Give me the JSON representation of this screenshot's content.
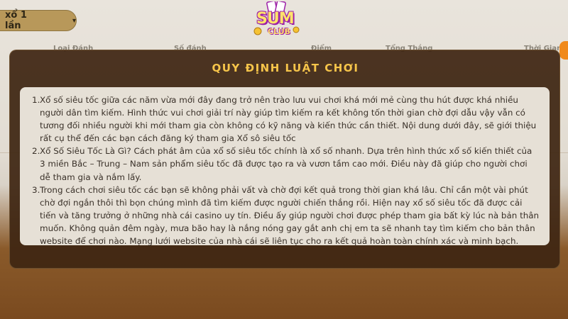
{
  "background": {
    "dropdown_label": "xổ 1 lần",
    "header_columns": [
      "Loại Đánh",
      "Số đánh",
      "Điểm",
      "Tổng Thắng",
      "Thời Gian"
    ],
    "logo": {
      "main": "SUM",
      "sub": "CLUB"
    }
  },
  "modal": {
    "title": "QUY ĐỊNH LUẬT CHƠI",
    "items": [
      {
        "num": "1.",
        "text": "Xổ số siêu tốc giữa các năm vừa mới đây đang trở nên trào lưu vui chơi khá mới mẻ cùng thu hút được khá nhiều người dân tìm kiếm. Hình thức vui chơi giải trí này giúp tìm kiếm ra kết không tốn thời gian chờ đợi dẫu vậy vẫn có tương đối nhiều người khi mới tham gia còn không có kỹ năng và kiến thức cần thiết. Nội dung dưới đây, sẽ giới thiệu rất cụ thể đến các bạn cách đăng ký tham gia Xổ sô siêu tốc"
      },
      {
        "num": "2.",
        "text": "Xổ Số Siêu Tốc Là Gì? Cách phát âm của xổ số siêu tốc chính là xổ số nhanh. Dựa trên hình thức xổ số kiến thiết của 3 miền Bắc – Trung – Nam sản phẩm siêu tốc đã được tạo ra và vươn tầm cao mới. Điều này đã giúp cho người chơi dễ tham gia và nắm lấy."
      },
      {
        "num": "3.",
        "text": "Trong cách chơi siêu tốc các bạn sẽ không phải vất và chờ đợi kết quả trong thời gian khá lâu. Chỉ cần một vài phút chờ đợi ngắn thôi thì bọn chúng mình đã tìm kiếm được người chiến thắng rồi. Hiện nay xổ số siêu tốc đã được cải tiến và tăng trưởng ở những nhà cái casino uy tín. Điều ấy giúp người chơi được phép tham gia bất kỳ lúc nà bản thân muốn. Không quản đêm ngày, mưa bão hay là nắng nóng gay gắt anh chị em ta sẽ nhanh tay tìm kiếm cho bản thân website để chơi nào. Mạng lưới website của nhà cái sẽ liên tục cho ra kết quả hoàn toàn chính xác và minh bạch."
      }
    ]
  },
  "colors": {
    "modal_bg": "#3e2612",
    "title": "#f6c54a",
    "content_bg": "#e6e0d6",
    "accent_orange": "#f08a1c"
  }
}
